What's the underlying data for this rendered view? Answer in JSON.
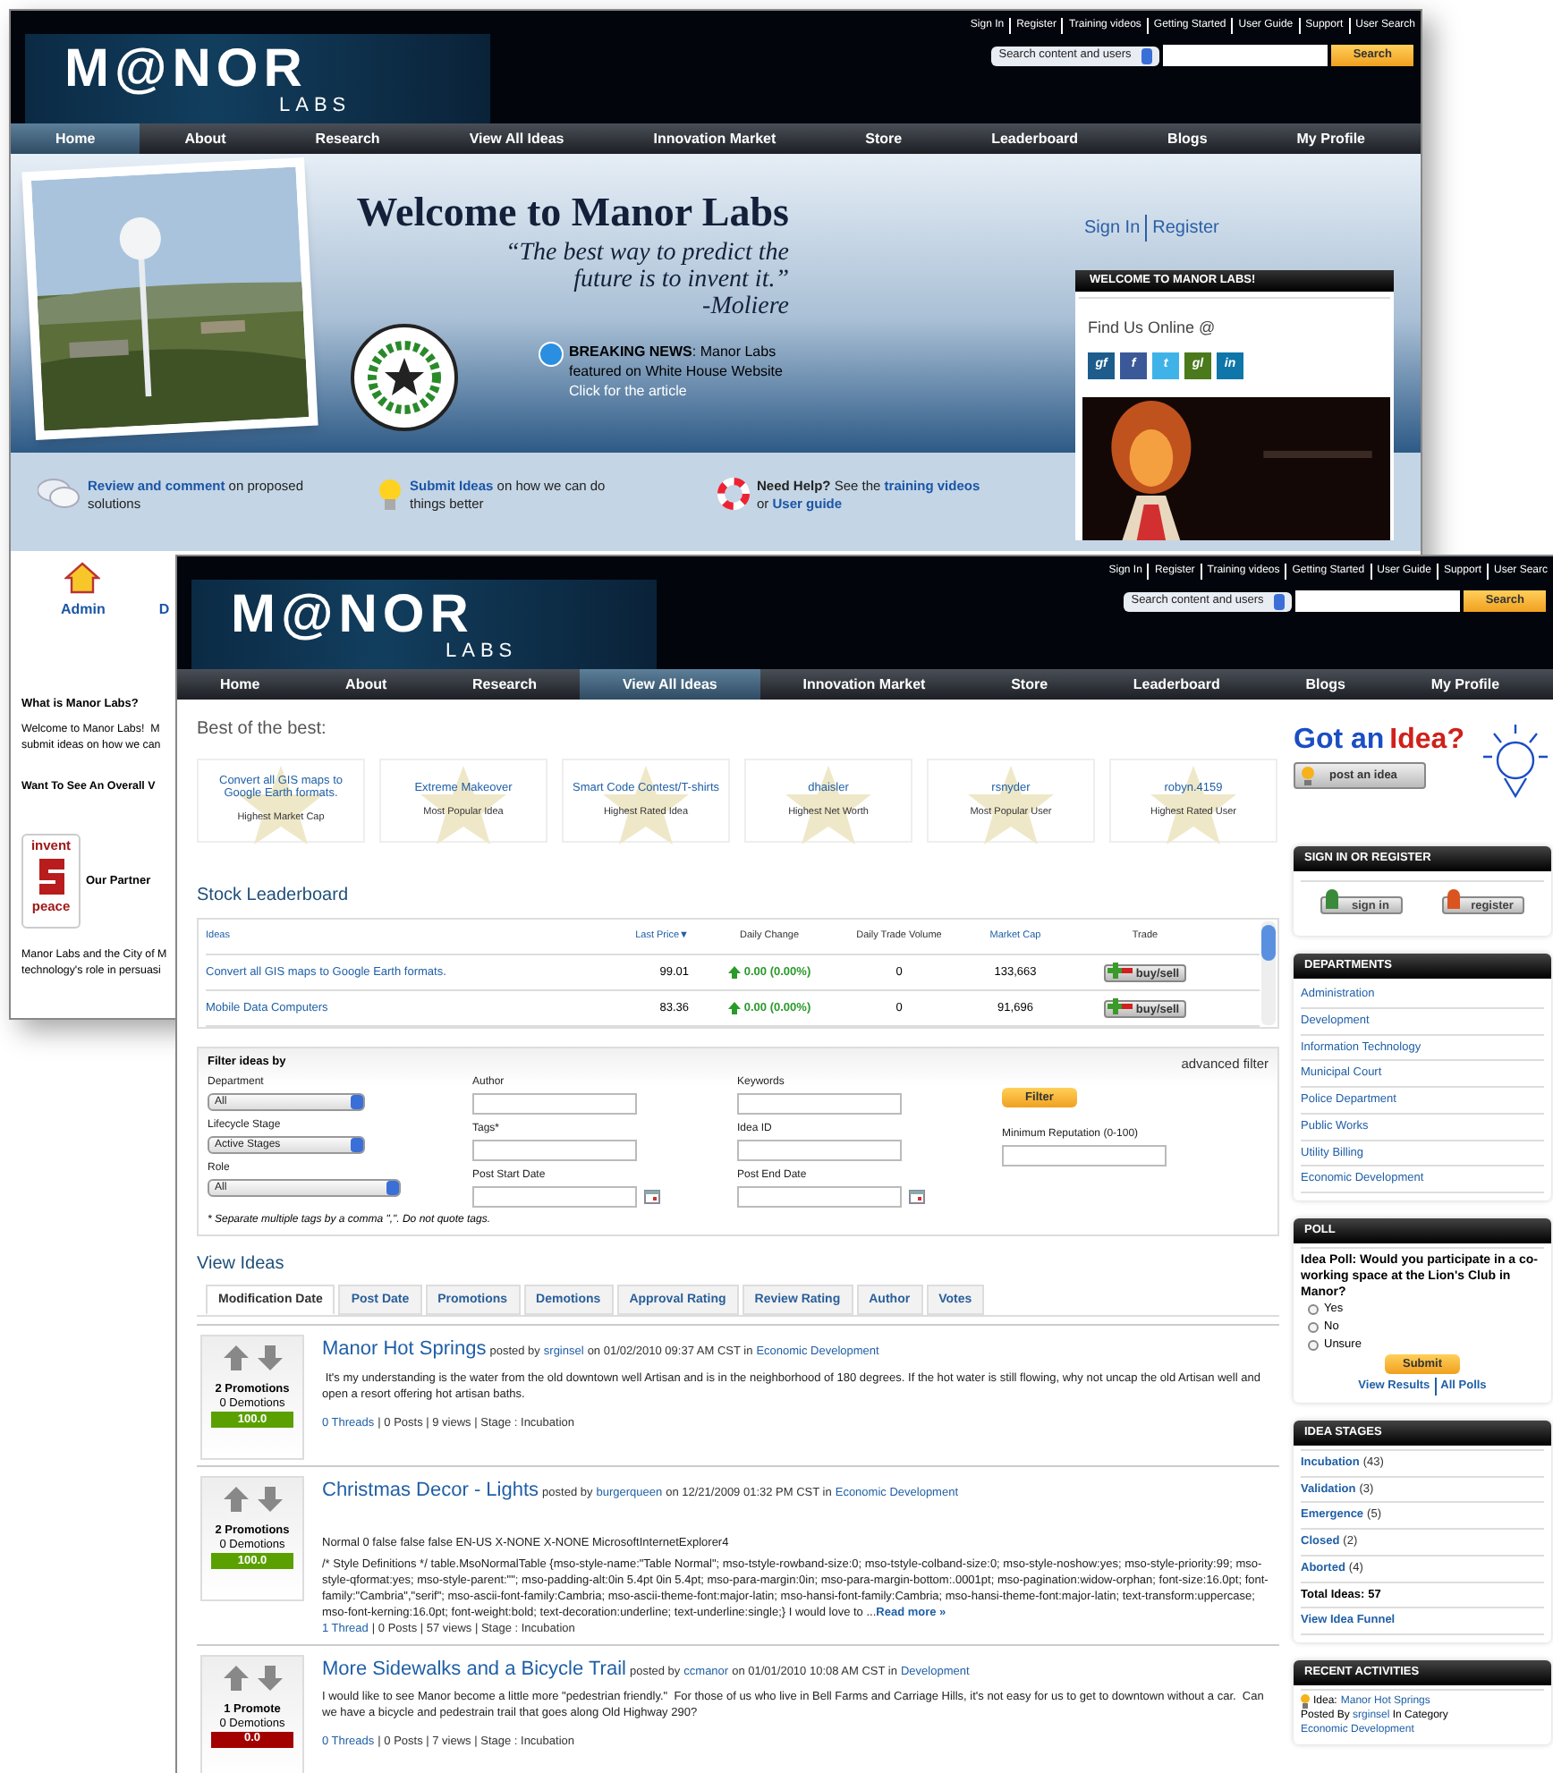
{
  "back_page": {
    "logo": {
      "wordmark": "M@NOR",
      "subtitle": "LABS"
    },
    "top_links": [
      "Sign In",
      "Register",
      "Training videos",
      "Getting Started",
      "User Guide",
      "Support",
      "User Search"
    ],
    "search": {
      "scope": "Search content and users",
      "button": "Search"
    },
    "nav": [
      {
        "label": "Home",
        "selected": true
      },
      {
        "label": "About",
        "selected": false
      },
      {
        "label": "Research",
        "selected": false
      },
      {
        "label": "View All Ideas",
        "selected": false
      },
      {
        "label": "Innovation Market",
        "selected": false
      },
      {
        "label": "Store",
        "selected": false
      },
      {
        "label": "Leaderboard",
        "selected": false
      },
      {
        "label": "Blogs",
        "selected": false
      },
      {
        "label": "My Profile",
        "selected": false
      }
    ],
    "hero": {
      "title": "Welcome to Manor Labs",
      "quote_lines": [
        "“The best way to predict the",
        "future is to invent it.”"
      ],
      "quote_author": "-Moliere",
      "news": "**BREAKING NEWS**: Manor Labs featured on White House Website",
      "news_link": "Click for the article"
    },
    "auth_links": [
      "Sign In",
      "Register"
    ],
    "welcome_box": {
      "title": "WELCOME TO MANOR LABS!",
      "find_us": "Find Us Online @",
      "social": [
        {
          "label": "gf",
          "color": "#1d5c8c"
        },
        {
          "label": "f",
          "color": "#3b5998"
        },
        {
          "label": "t",
          "color": "#3fb3e8"
        },
        {
          "label": "gl",
          "color": "#4a7a1c"
        },
        {
          "label": "in",
          "color": "#0e76a8"
        }
      ]
    },
    "features": [
      {
        "kind": "comment",
        "segments": [
          {
            "kind": "link",
            "text": "Review and comment"
          },
          {
            "kind": "plain",
            "text": " on proposed solutions"
          }
        ]
      },
      {
        "kind": "idea",
        "segments": [
          {
            "kind": "link",
            "text": "Submit Ideas"
          },
          {
            "kind": "plain",
            "text": " on how we can do things better"
          }
        ]
      },
      {
        "kind": "help",
        "segments": [
          {
            "kind": "bold",
            "text": "Need Help?"
          },
          {
            "kind": "plain",
            "text": " See the "
          },
          {
            "kind": "link",
            "text": "training videos"
          },
          {
            "kind": "plain",
            "text": " or "
          },
          {
            "kind": "link",
            "text": "User guide"
          }
        ]
      }
    ],
    "shortcuts": [
      "Admin",
      "D"
    ],
    "about": {
      "heading": "What is Manor Labs?",
      "lines": [
        "Welcome to Manor Labs!  M",
        "submit ideas on how we can"
      ],
      "heading2": "Want To See An Overall V"
    },
    "partner": {
      "logo_top": "invent",
      "logo_bottom": "peace",
      "label": "Our Partner",
      "lines": [
        "Manor Labs and the City of M",
        "technology's role in persuasi"
      ]
    }
  },
  "front_page": {
    "logo": {
      "wordmark": "M@NOR",
      "subtitle": "LABS"
    },
    "top_links": [
      "Sign In",
      "Register",
      "Training videos",
      "Getting Started",
      "User Guide",
      "Support",
      "User Searc"
    ],
    "search": {
      "scope": "Search content and users",
      "button": "Search"
    },
    "nav": [
      {
        "label": "Home",
        "selected": false
      },
      {
        "label": "About",
        "selected": false
      },
      {
        "label": "Research",
        "selected": false
      },
      {
        "label": "View All Ideas",
        "selected": true
      },
      {
        "label": "Innovation Market",
        "selected": false
      },
      {
        "label": "Store",
        "selected": false
      },
      {
        "label": "Leaderboard",
        "selected": false
      },
      {
        "label": "Blogs",
        "selected": false
      },
      {
        "label": "My Profile",
        "selected": false
      }
    ],
    "best_of": {
      "title": "Best of the best:",
      "cards": [
        {
          "name": "Convert all GIS maps to Google Earth formats.",
          "caption": "Highest Market Cap"
        },
        {
          "name": "Extreme Makeover",
          "caption": "Most Popular Idea"
        },
        {
          "name": "Smart Code Contest/T-shirts",
          "caption": "Highest Rated Idea"
        },
        {
          "name": "dhaisler",
          "caption": "Highest Net Worth"
        },
        {
          "name": "rsnyder",
          "caption": "Most Popular User"
        },
        {
          "name": "robyn.4159",
          "caption": "Highest Rated User"
        }
      ]
    },
    "leaderboard": {
      "title": "Stock Leaderboard",
      "columns": [
        {
          "label": "Ideas",
          "kind": "link"
        },
        {
          "label": "Last Price▼",
          "kind": "link"
        },
        {
          "label": "Daily Change",
          "kind": "plain"
        },
        {
          "label": "Daily Trade Volume",
          "kind": "plain"
        },
        {
          "label": "Market Cap",
          "kind": "link"
        },
        {
          "label": "Trade",
          "kind": "plain"
        }
      ],
      "rows": [
        {
          "idea": "Convert all GIS maps to Google Earth formats.",
          "price": "99.01",
          "change": "0.00 (0.00%)",
          "volume": "0",
          "cap": "133,663",
          "trade": "buy/sell"
        },
        {
          "idea": "Mobile Data Computers",
          "price": "83.36",
          "change": "0.00 (0.00%)",
          "volume": "0",
          "cap": "91,696",
          "trade": "buy/sell"
        }
      ]
    },
    "filter": {
      "title": "Filter ideas by",
      "advanced": "advanced filter",
      "columns": [
        [
          {
            "kind": "select",
            "label": "Department",
            "value": "All"
          },
          {
            "kind": "select",
            "label": "Lifecycle Stage",
            "value": "Active Stages"
          },
          {
            "kind": "select",
            "label": "Role",
            "value": "All"
          }
        ],
        [
          {
            "kind": "text",
            "label": "Author"
          },
          {
            "kind": "text",
            "label": "Tags*"
          },
          {
            "kind": "date",
            "label": "Post Start Date"
          }
        ],
        [
          {
            "kind": "text",
            "label": "Keywords"
          },
          {
            "kind": "text",
            "label": "Idea ID"
          },
          {
            "kind": "date",
            "label": "Post End Date"
          }
        ],
        [
          {
            "kind": "button",
            "label": "Filter"
          },
          {
            "kind": "text",
            "label": "Minimum Reputation (0-100)"
          }
        ]
      ],
      "note": "* Separate multiple tags by a comma \",\". Do not quote tags."
    },
    "view_ideas": {
      "title": "View Ideas",
      "tabs": [
        {
          "label": "Modification Date",
          "selected": true
        },
        {
          "label": "Post Date",
          "selected": false
        },
        {
          "label": "Promotions",
          "selected": false
        },
        {
          "label": "Demotions",
          "selected": false
        },
        {
          "label": "Approval Rating",
          "selected": false
        },
        {
          "label": "Review Rating",
          "selected": false
        },
        {
          "label": "Author",
          "selected": false
        },
        {
          "label": "Votes",
          "selected": false
        }
      ],
      "ideas": [
        {
          "title": "Manor Hot Springs",
          "posted_by": "posted by",
          "author": "srginsel",
          "on": "on 01/02/2010 09:37 AM CST in",
          "category": "Economic Development",
          "body": [
            " It's my understanding is the water from the old downtown well Artisan and is in the neighborhood of 180 degrees. If the hot water is still flowing, why not uncap the old Artisan well and open a resort offering hot artisan baths."
          ],
          "threads": "0 Threads",
          "stats": "| 0 Posts | 9 views | Stage : Incubation",
          "promotions": "2 Promotions",
          "demotions": "0 Demotions",
          "score": "100.0",
          "color": "#5aa000"
        },
        {
          "title": "Christmas Decor - Lights",
          "posted_by": "posted by",
          "author": "burgerqueen",
          "on": "on 12/21/2009 01:32 PM CST in",
          "category": "Economic Development",
          "body": [
            "Normal 0 false false false EN-US X-NONE X-NONE MicrosoftInternetExplorer4",
            "/* Style Definitions */ table.MsoNormalTable {mso-style-name:\"Table Normal\"; mso-tstyle-rowband-size:0; mso-tstyle-colband-size:0; mso-style-noshow:yes; mso-style-priority:99; mso-style-qformat:yes; mso-style-parent:\"\"; mso-padding-alt:0in 5.4pt 0in 5.4pt; mso-para-margin:0in; mso-para-margin-bottom:.0001pt; mso-pagination:widow-orphan; font-size:16.0pt; font-family:\"Cambria\",\"serif\"; mso-ascii-font-family:Cambria; mso-ascii-theme-font:major-latin; mso-hansi-font-family:Cambria; mso-hansi-theme-font:major-latin; text-transform:uppercase; mso-font-kerning:16.0pt; font-weight:bold; text-decoration:underline; text-underline:single;} I would love to ..."
          ],
          "read_more": "Read more »",
          "threads": "1 Thread",
          "stats": "| 0 Posts | 57 views | Stage : Incubation",
          "promotions": "2 Promotions",
          "demotions": "0 Demotions",
          "score": "100.0",
          "color": "#5aa000"
        },
        {
          "title": "More Sidewalks and a Bicycle Trail",
          "posted_by": "posted by",
          "author": "ccmanor",
          "on": "on 01/01/2010 10:08 AM CST in",
          "category": "Development",
          "body": [
            "I would like to see Manor become a little more \"pedestrian friendly.\"  For those of us who live in Bell Farms and Carriage Hills, it's not easy for us to get to downtown without a car.  Can we have a bicycle and pedestrain trail that goes along Old Highway 290?"
          ],
          "threads": "0 Threads",
          "stats": "| 0 Posts | 7 views | Stage : Incubation",
          "promotions": "1 Promote",
          "demotions": "0 Demotions",
          "score": "0.0",
          "color": "#a30000"
        }
      ]
    },
    "sidebar": {
      "got_idea": {
        "lead": "Got an",
        "accent": "Idea?",
        "button": "post an idea"
      },
      "sign_in": {
        "title": "SIGN IN OR REGISTER",
        "buttons": [
          {
            "label": "sign in",
            "color": "#3a8a3a"
          },
          {
            "label": "register",
            "color": "#d9541e"
          }
        ]
      },
      "departments": {
        "title": "DEPARTMENTS",
        "items": [
          "Administration",
          "Development",
          "Information Technology",
          "Municipal Court",
          "Police Department",
          "Public Works",
          "Utility Billing",
          "Economic Development"
        ]
      },
      "poll": {
        "title": "POLL",
        "question": "Idea Poll: Would you participate in a co-working space at the Lion's Club in Manor?",
        "options": [
          {
            "label": "Yes",
            "selected": false
          },
          {
            "label": "No",
            "selected": false
          },
          {
            "label": "Unsure",
            "selected": false
          }
        ],
        "submit": "Submit",
        "results": "View Results",
        "all_polls": "All Polls"
      },
      "stages": {
        "title": "IDEA STAGES",
        "items": [
          {
            "label": "Incubation",
            "count": "(43)"
          },
          {
            "label": "Validation",
            "count": "(3)"
          },
          {
            "label": "Emergence",
            "count": "(5)"
          },
          {
            "label": "Closed",
            "count": "(2)"
          },
          {
            "label": "Aborted",
            "count": "(4)"
          }
        ],
        "total_label": "Total Ideas:",
        "total": "57",
        "funnel": "View Idea Funnel"
      },
      "recent": {
        "title": "RECENT ACTIVITIES",
        "items": [
          {
            "label": "Idea:",
            "link": "Manor Hot Springs",
            "by": "Posted By",
            "user": "srginsel",
            "in": "In Category",
            "category": "Economic Development"
          }
        ]
      }
    }
  }
}
